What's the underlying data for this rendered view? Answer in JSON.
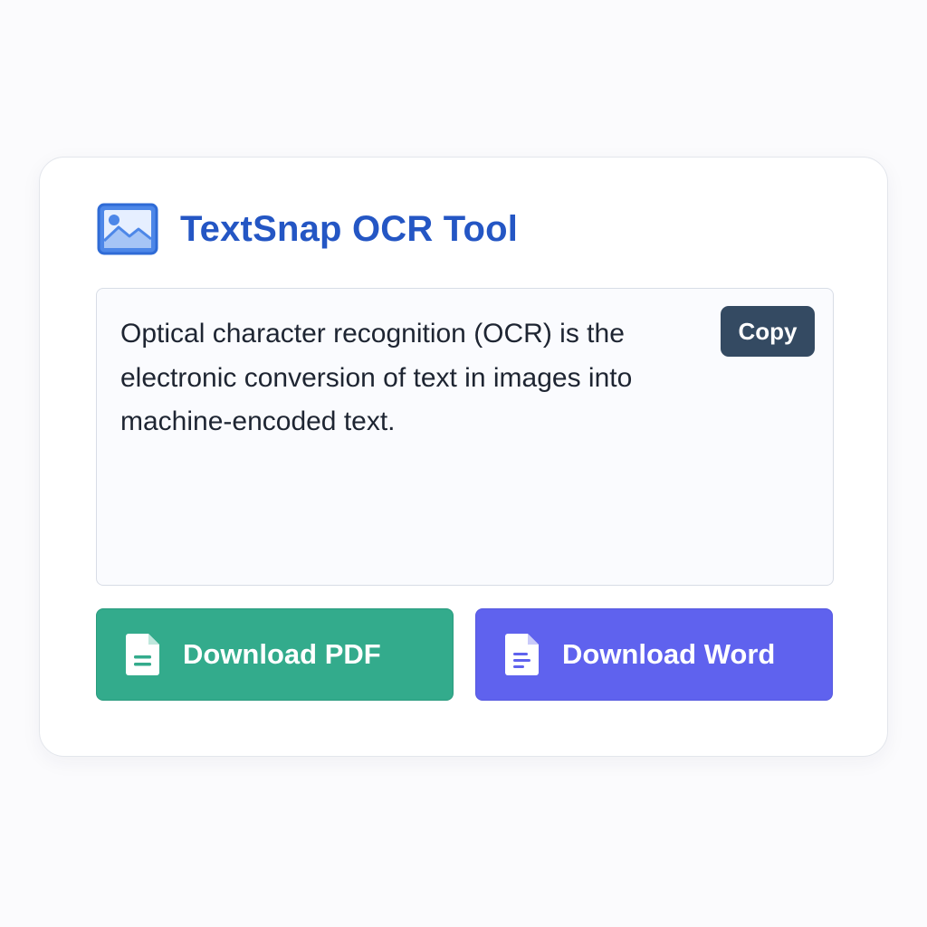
{
  "app": {
    "title": "TextSnap OCR Tool",
    "icon": "image-icon"
  },
  "ocr": {
    "text": "Optical character recognition (OCR) is the electronic conversion of text in images into machine-encoded text.",
    "copy_label": "Copy"
  },
  "actions": [
    {
      "label": "Download PDF",
      "icon": "document-icon",
      "color": "#33ab8c"
    },
    {
      "label": "Download Word",
      "icon": "document-icon",
      "color": "#5f62ee"
    }
  ],
  "colors": {
    "title": "#2456c4",
    "copy_button": "#344a62",
    "background": "#fbfbfd"
  }
}
